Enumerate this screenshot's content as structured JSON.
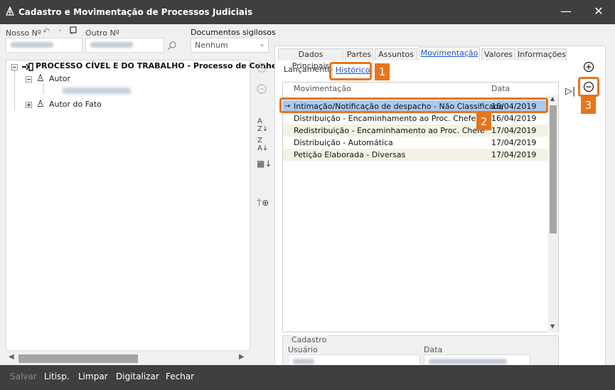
{
  "window": {
    "title": "Cadastro e Movimentação de Processos Judiciais",
    "minimize": "—",
    "close": "✕"
  },
  "header": {
    "nosso_label": "Nosso Nº",
    "outro_label": "Outro Nº",
    "documentos_label": "Documentos sigilosos",
    "documentos_value": "Nenhum"
  },
  "tree": {
    "root": "PROCESSO CÍVEL E DO TRABALHO - Processo de Conhecimento",
    "autor": "Autor",
    "autor_do_fato": "Autor do Fato"
  },
  "tabs": [
    "Dados Principais",
    "Partes",
    "Assuntos",
    "Movimentação",
    "Valores",
    "Informações"
  ],
  "subtabs": [
    "Lançamento",
    "Histórico"
  ],
  "grid": {
    "col_mov": "Movimentação",
    "col_data": "Data",
    "rows": [
      {
        "mov": "Intimação/Notificação de despacho - Não Classificada",
        "data": "16/04/2019"
      },
      {
        "mov": "Distribuição - Encaminhamento ao Proc. Chefe",
        "data": "16/04/2019"
      },
      {
        "mov": "Redistribuição - Encaminhamento ao Proc. Chefe",
        "data": "17/04/2019"
      },
      {
        "mov": "Distribuição - Automática",
        "data": "17/04/2019"
      },
      {
        "mov": "Petição Elaborada - Diversas",
        "data": "17/04/2019"
      }
    ]
  },
  "cadastro": {
    "legend": "Cadastro",
    "usuario_label": "Usuário",
    "data_label": "Data"
  },
  "badges": [
    "1",
    "2",
    "3"
  ],
  "statusbar": [
    "Salvar",
    "Litisp.",
    "Limpar",
    "Digitalizar",
    "Fechar"
  ],
  "colors": {
    "accent": "#e8751a",
    "selection": "#aac9ef",
    "link": "#1a4fd6"
  }
}
